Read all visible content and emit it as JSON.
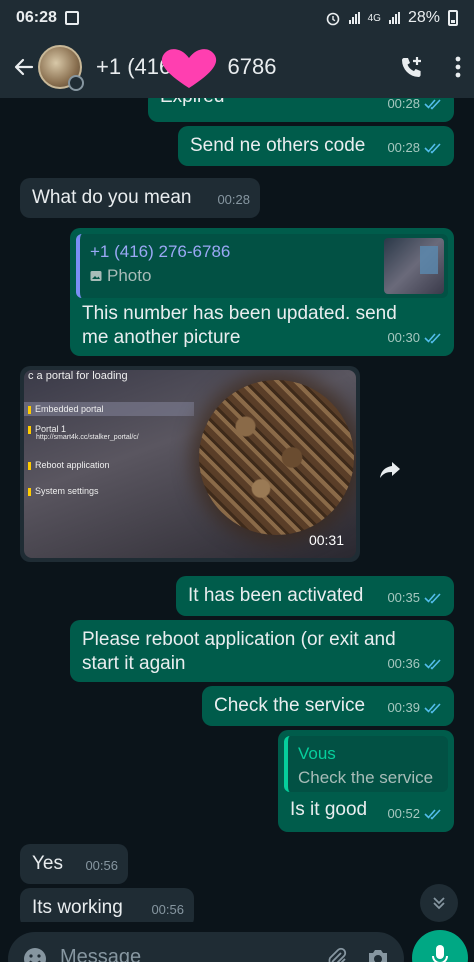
{
  "status_bar": {
    "time": "06:28",
    "network": "4G",
    "battery": "28%"
  },
  "header": {
    "contact_prefix": "+1 (416",
    "contact_suffix": "6786",
    "back_icon": "arrow-left-icon",
    "add_call_icon": "phone-plus-icon",
    "menu_icon": "vertical-dots-icon"
  },
  "messages": [
    {
      "text": "Expired",
      "time": "00:28",
      "dir": "out"
    },
    {
      "text": "Send ne others code",
      "time": "00:28",
      "dir": "out"
    },
    {
      "text": "What do you mean",
      "time": "00:28",
      "dir": "in"
    },
    {
      "quote_name": "+1 (416) 276-6786",
      "quote_sub": "Photo",
      "text": "This number has been updated.  send me another picture",
      "time": "00:30",
      "dir": "out"
    },
    {
      "image_time": "00:31",
      "dir": "in",
      "tv_menu": {
        "title": "c a portal for loading",
        "item1": "Embedded portal",
        "item2": "Portal 1",
        "item2_url": "http://smart4k.cc/stalker_portal/c/",
        "item3": "Reboot application",
        "item4": "System settings"
      }
    },
    {
      "text": "It has been activated",
      "time": "00:35",
      "dir": "out"
    },
    {
      "text": "Please reboot application (or exit and start it again",
      "time": "00:36",
      "dir": "out"
    },
    {
      "text": "Check the service",
      "time": "00:39",
      "dir": "out"
    },
    {
      "quote_name": "Vous",
      "quote_sub": "Check the service",
      "text": "Is it good",
      "time": "00:52",
      "dir": "out"
    },
    {
      "text": "Yes",
      "time": "00:56",
      "dir": "in"
    },
    {
      "text": "Its working",
      "time": "00:56",
      "dir": "in"
    }
  ],
  "input": {
    "placeholder": "Message"
  },
  "colors": {
    "outgoing_bubble": "#005c4b",
    "incoming_bubble": "#1f2c34",
    "accent": "#00a884",
    "ticks": "#53bdeb"
  }
}
